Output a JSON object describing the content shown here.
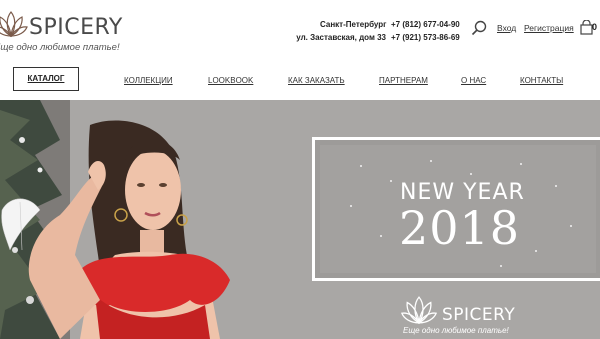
{
  "brand": {
    "name": "SPICERY",
    "slogan": "Еще одно любимое платье!"
  },
  "contacts": {
    "city": "Санкт-Петербург",
    "address": "ул. Заставская, дом 33",
    "phone_1": "+7 (812) 677-04-90",
    "phone_2": "+7 (921) 573-86-69"
  },
  "auth": {
    "login": "Вход",
    "register": "Регистрация"
  },
  "cart": {
    "count": "0"
  },
  "nav": {
    "catalog": "КАТАЛОГ",
    "items": [
      "КОЛЛЕКЦИИ",
      "LOOKBOOK",
      "КАК ЗАКАЗАТЬ",
      "ПАРТНЕРАМ",
      "О НАС",
      "КОНТАКТЫ"
    ]
  },
  "hero": {
    "title": "NEW YEAR",
    "year": "2018",
    "logo_text": "SPICERY",
    "logo_slogan": "Еще одно любимое платье!"
  },
  "colors": {
    "hero_bg": "#a9a7a5",
    "dress": "#d92a2a",
    "text": "#333333"
  }
}
